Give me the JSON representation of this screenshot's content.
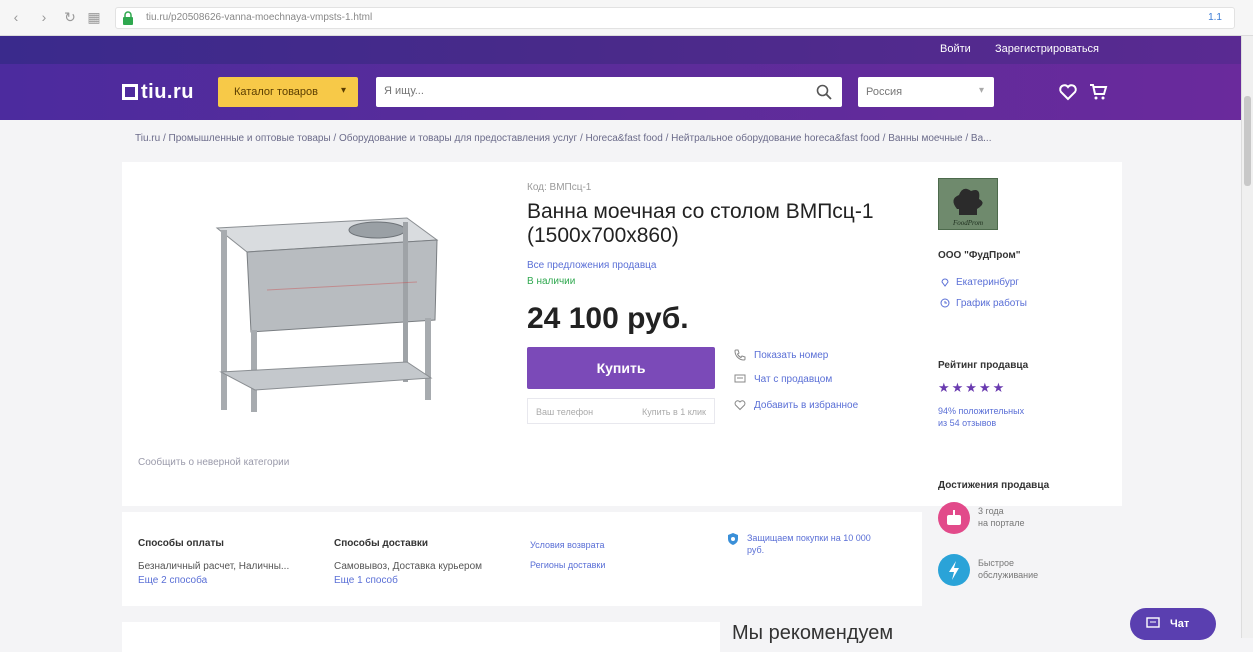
{
  "browser": {
    "url": "tiu.ru/p20508626-vanna-moechnaya-vmpsts-1.html",
    "ext_label": "1.1"
  },
  "topbar": {
    "login": "Войти",
    "register": "Зарегистрироваться"
  },
  "header": {
    "logo": "tiu.ru",
    "catalog_label": "Каталог товаров",
    "search_placeholder": "Я ищу...",
    "region": "Россия"
  },
  "breadcrumb": "Tiu.ru / Промышленные и оптовые товары / Оборудование и товары для предоставления услуг / Horeca&fast food / Нейтральное оборудование horeca&fast food / Ванны моечные / Ва...",
  "product": {
    "code": "Код: ВМПсц-1",
    "title": "Ванна моечная со столом ВМПсц-1 (1500х700х860)",
    "seller_offers": "Все предложения продавца",
    "availability": "В наличии",
    "price": "24 100 руб.",
    "buy_label": "Купить",
    "phone_placeholder": "Ваш телефон",
    "one_click": "Купить в 1 клик",
    "report": "Сообщить о неверной категории",
    "actions": [
      {
        "label": "Показать номер"
      },
      {
        "label": "Чат с продавцом"
      },
      {
        "label": "Добавить в избранное"
      }
    ]
  },
  "seller": {
    "logo_text": "FoodProm",
    "name": "ООО \"ФудПром\"",
    "city": "Екатеринбург",
    "schedule": "График работы",
    "rating_title": "Рейтинг продавца",
    "stars": "★★★★★",
    "rating_line1": "94% положительных",
    "rating_line2": "из 54 отзывов",
    "achievements_title": "Достижения продавца",
    "ach1_line1": "3 года",
    "ach1_line2": "на портале",
    "ach2_line1": "Быстрое",
    "ach2_line2": "обслуживание"
  },
  "info": {
    "payment_title": "Способы оплаты",
    "payment_text": "Безналичный расчет, Наличны...",
    "payment_more": "Еще 2 способа",
    "delivery_title": "Способы доставки",
    "delivery_text": "Самовывоз, Доставка курьером",
    "delivery_more": "Еще 1 способ",
    "return_link": "Условия возврата",
    "regions_link": "Регионы доставки",
    "protect_text": "Защищаем покупки на 10 000 руб."
  },
  "recommend_title": "Мы рекомендуем",
  "chat_label": "Чат",
  "colors": {
    "purple": "#5a2c9a",
    "accent": "#f7c948",
    "buy": "#7b4ab8",
    "link": "#5a6fd6"
  }
}
